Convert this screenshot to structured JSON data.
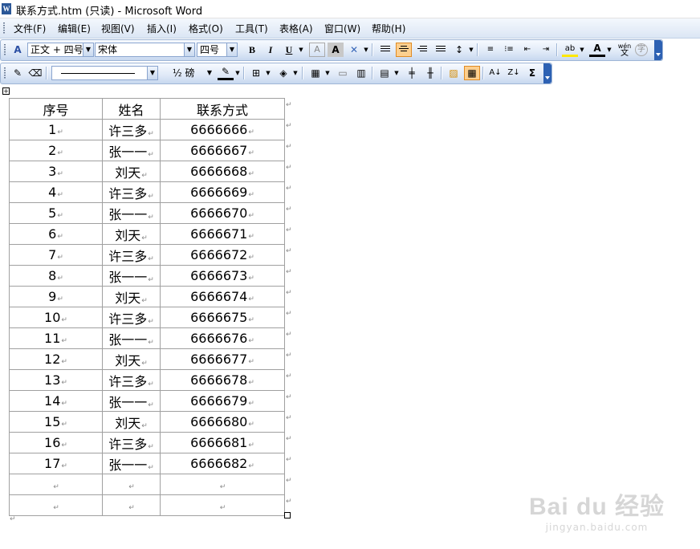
{
  "window": {
    "title": "联系方式.htm (只读) - Microsoft Word",
    "app_icon": "W"
  },
  "menu": [
    "文件(F)",
    "编辑(E)",
    "视图(V)",
    "插入(I)",
    "格式(O)",
    "工具(T)",
    "表格(A)",
    "窗口(W)",
    "帮助(H)"
  ],
  "toolbar1": {
    "style_value": "正文 + 四号",
    "font_value": "宋体",
    "size_value": "四号",
    "bold_label": "B",
    "italic_label": "I",
    "underline_label": "U",
    "font_color_label": "A",
    "highlight_label": "ab",
    "phonetic_label": "wén",
    "enclose_label": "字"
  },
  "toolbar2": {
    "line_weight_value": "½ 磅",
    "sort_label": "Σ"
  },
  "table": {
    "headers": [
      "序号",
      "姓名",
      "联系方式"
    ],
    "rows": [
      [
        "1",
        "许三多",
        "6666666"
      ],
      [
        "2",
        "张一一",
        "6666667"
      ],
      [
        "3",
        "刘天",
        "6666668"
      ],
      [
        "4",
        "许三多",
        "6666669"
      ],
      [
        "5",
        "张一一",
        "6666670"
      ],
      [
        "6",
        "刘天",
        "6666671"
      ],
      [
        "7",
        "许三多",
        "6666672"
      ],
      [
        "8",
        "张一一",
        "6666673"
      ],
      [
        "9",
        "刘天",
        "6666674"
      ],
      [
        "10",
        "许三多",
        "6666675"
      ],
      [
        "11",
        "张一一",
        "6666676"
      ],
      [
        "12",
        "刘天",
        "6666677"
      ],
      [
        "13",
        "许三多",
        "6666678"
      ],
      [
        "14",
        "张一一",
        "6666679"
      ],
      [
        "15",
        "刘天",
        "6666680"
      ],
      [
        "16",
        "许三多",
        "6666681"
      ],
      [
        "17",
        "张一一",
        "6666682"
      ],
      [
        "",
        "",
        ""
      ],
      [
        "",
        "",
        ""
      ]
    ],
    "paragraph_mark": "↵"
  },
  "watermark": {
    "logo": "Bai du 经验",
    "url": "jingyan.baidu.com"
  }
}
